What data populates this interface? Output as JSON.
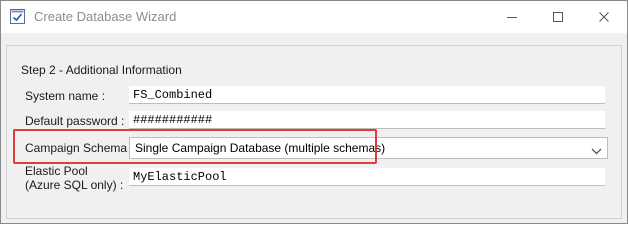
{
  "window": {
    "title": "Create Database Wizard"
  },
  "wizard": {
    "step_title": "Step 2 - Additional Information",
    "fields": {
      "system_name": {
        "label": "System name :",
        "value": "FS_Combined"
      },
      "default_password": {
        "label": "Default password :",
        "value": "###########"
      },
      "campaign_schema": {
        "label": "Campaign Schema :",
        "selected": "Single Campaign Database (multiple schemas)"
      },
      "elastic_pool": {
        "label_line1": "Elastic Pool",
        "label_line2": "(Azure SQL only) :",
        "value": "MyElasticPool"
      }
    }
  },
  "annotation": {
    "highlight_color": "#e03c3c"
  },
  "icons": {
    "app": "wizard-checkmark-icon",
    "minimize": "minimize-icon",
    "maximize": "maximize-icon",
    "close": "close-icon",
    "dropdown": "chevron-down-icon"
  }
}
